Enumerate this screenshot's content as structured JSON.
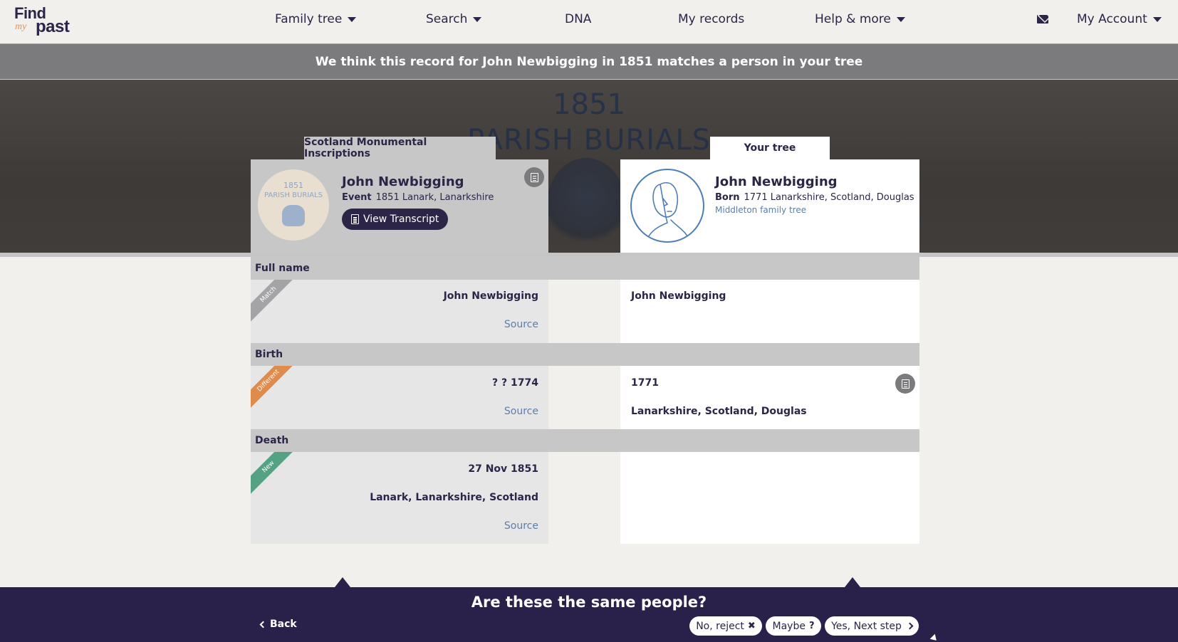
{
  "nav": {
    "logo_find": "Find",
    "logo_my": "my",
    "logo_past": "past",
    "items": [
      {
        "label": "Family tree",
        "has_dropdown": true
      },
      {
        "label": "Search",
        "has_dropdown": true
      },
      {
        "label": "DNA",
        "has_dropdown": false
      },
      {
        "label": "My records",
        "has_dropdown": false
      },
      {
        "label": "Help & more",
        "has_dropdown": true
      }
    ],
    "mail_icon": "envelope-icon",
    "account_label": "My Account"
  },
  "banner": {
    "text": "We think this record for John Newbigging in 1851 matches a person in your tree"
  },
  "hero": {
    "year": "1851",
    "subtitle": "PARISH BURIALS"
  },
  "record": {
    "tab_label": "Scotland Monumental Inscriptions",
    "thumb_year": "1851",
    "thumb_title": "PARISH BURIALS",
    "name": "John Newbigging",
    "event_label": "Event",
    "event_value": "1851 Lanark, Lanarkshire",
    "transcript_button": "View Transcript"
  },
  "tree": {
    "tab_label": "Your tree",
    "name": "John Newbigging",
    "born_label": "Born",
    "born_value": "1771 Lanarkshire, Scotland, Douglas",
    "tree_link": "Middleton family tree"
  },
  "sections": {
    "full_name": {
      "title": "Full name",
      "badge": "Match",
      "record_value": "John Newbigging",
      "record_source": "Source",
      "tree_value": "John Newbigging"
    },
    "birth": {
      "title": "Birth",
      "badge": "Different",
      "record_value": "? ? 1774",
      "record_source": "Source",
      "tree_date": "1771",
      "tree_place": "Lanarkshire, Scotland, Douglas"
    },
    "death": {
      "title": "Death",
      "badge": "New",
      "record_date": "27 Nov 1851",
      "record_place": "Lanark, Lanarkshire, Scotland",
      "record_source": "Source"
    }
  },
  "footer": {
    "question": "Are these the same people?",
    "back_label": "Back",
    "reject_label": "No, reject",
    "reject_glyph": "✖",
    "maybe_label": "Maybe",
    "maybe_glyph": "?",
    "yes_label": "Yes, Next step"
  },
  "colors": {
    "brand_navy": "#2c2548",
    "logo_orange": "#e0955a",
    "match_badge": "#a4a3a5",
    "different_badge": "#df8b4c",
    "new_badge": "#55a184",
    "link_blue": "#5d7ea8"
  }
}
